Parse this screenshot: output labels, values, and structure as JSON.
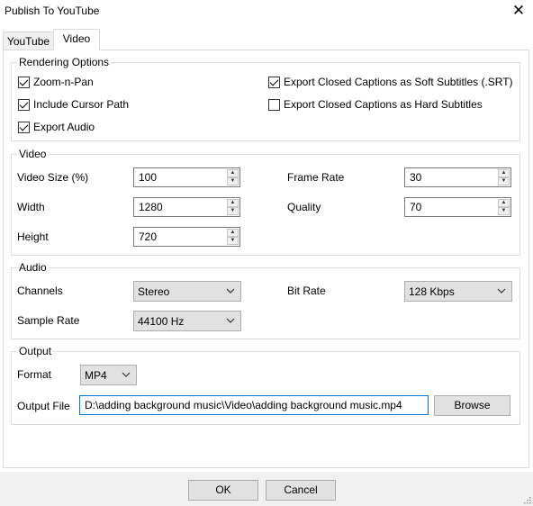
{
  "window": {
    "title": "Publish To YouTube",
    "close_glyph": "✕"
  },
  "tabs": [
    {
      "label": "YouTube",
      "selected": false
    },
    {
      "label": "Video",
      "selected": true
    }
  ],
  "rendering": {
    "label": "Rendering Options",
    "zoom_n_pan": {
      "label": "Zoom-n-Pan",
      "checked": true
    },
    "include_cursor_path": {
      "label": "Include Cursor Path",
      "checked": true
    },
    "export_audio": {
      "label": "Export Audio",
      "checked": true
    },
    "soft_subtitles": {
      "label": "Export Closed Captions as Soft Subtitles (.SRT)",
      "checked": true
    },
    "hard_subtitles": {
      "label": "Export Closed Captions as Hard Subtitles",
      "checked": false
    }
  },
  "video": {
    "label": "Video",
    "video_size_label": "Video Size (%)",
    "video_size": "100",
    "width_label": "Width",
    "width": "1280",
    "height_label": "Height",
    "height": "720",
    "frame_rate_label": "Frame Rate",
    "frame_rate": "30",
    "quality_label": "Quality",
    "quality": "70"
  },
  "audio": {
    "label": "Audio",
    "channels_label": "Channels",
    "channels": "Stereo",
    "sample_rate_label": "Sample Rate",
    "sample_rate": "44100 Hz",
    "bit_rate_label": "Bit Rate",
    "bit_rate": "128 Kbps"
  },
  "output": {
    "label": "Output",
    "format_label": "Format",
    "format": "MP4",
    "output_file_label": "Output File",
    "output_file": "D:\\adding background music\\Video\\adding background music.mp4",
    "browse_label": "Browse"
  },
  "buttons": {
    "ok": "OK",
    "cancel": "Cancel"
  },
  "icons": {
    "spin_up": "▲",
    "spin_down": "▼",
    "dropdown": "chevron-down-icon",
    "grip": "resize-grip-icon"
  },
  "colors": {
    "focus_border": "#0078d7",
    "button_face": "#e1e1e1",
    "group_border": "#dcdcdc"
  }
}
